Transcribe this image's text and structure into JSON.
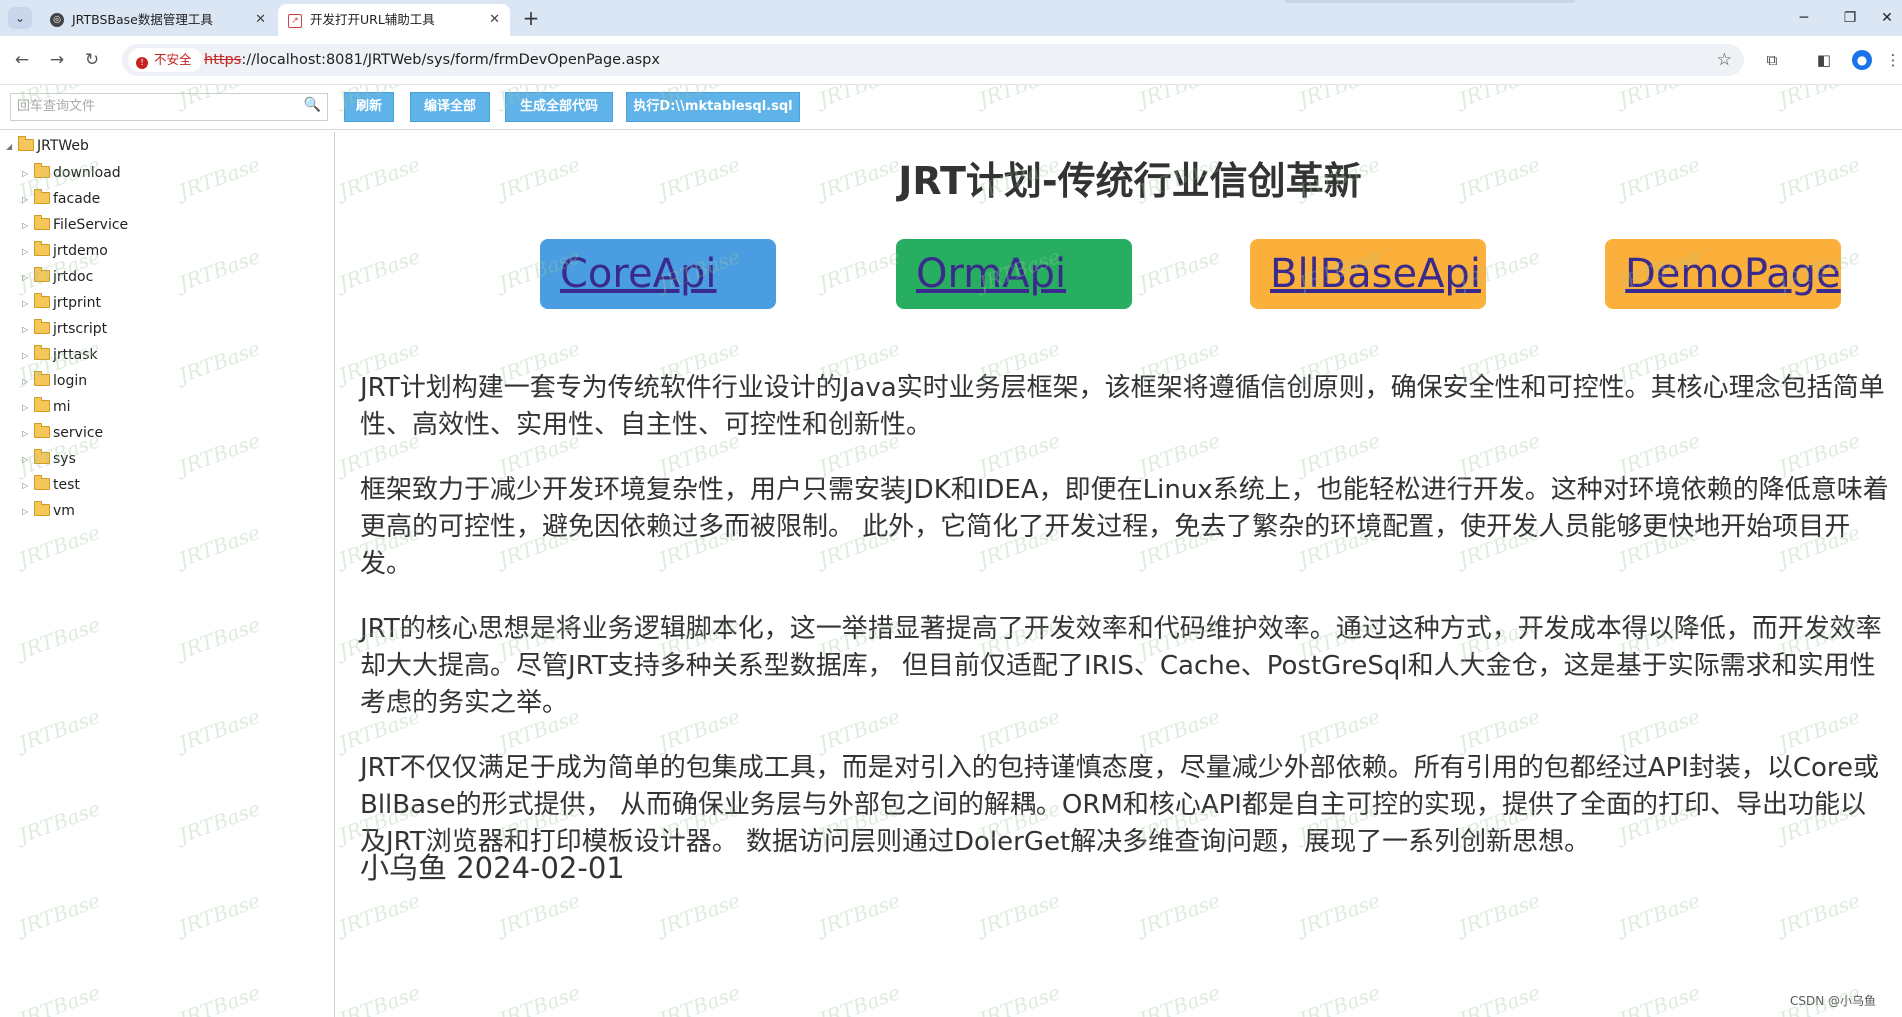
{
  "browser": {
    "tabs": [
      {
        "title": "JRTBSBase数据管理工具",
        "active": false
      },
      {
        "title": "开发打开URL辅助工具",
        "active": true
      }
    ],
    "security_label": "不安全",
    "url_scheme": "https",
    "url_rest": "://localhost:8081/JRTWeb/sys/form/frmDevOpenPage.aspx"
  },
  "toolbar": {
    "search_placeholder": "回车查询文件",
    "buttons": [
      "刷新",
      "编译全部",
      "生成全部代码",
      "执行D:\\\\mktablesql.sql"
    ]
  },
  "tree": {
    "root": "JRTWeb",
    "items": [
      "download",
      "facade",
      "FileService",
      "jrtdemo",
      "jrtdoc",
      "jrtprint",
      "jrtscript",
      "jrttask",
      "login",
      "mi",
      "service",
      "sys",
      "test",
      "vm"
    ]
  },
  "content": {
    "title": "JRT计划-传统行业信创革新",
    "links": [
      {
        "label": "CoreApi",
        "color": "#4a9de0"
      },
      {
        "label": "OrmApi",
        "color": "#27ae60"
      },
      {
        "label": "BllBaseApi",
        "color": "#fbb03b"
      },
      {
        "label": "DemoPage",
        "color": "#fbb03b"
      }
    ],
    "paragraphs": [
      "JRT计划构建一套专为传统软件行业设计的Java实时业务层框架，该框架将遵循信创原则，确保安全性和可控性。其核心理念包括简单性、高效性、实用性、自主性、可控性和创新性。",
      "框架致力于减少开发环境复杂性，用户只需安装JDK和IDEA，即便在Linux系统上，也能轻松进行开发。这种对环境依赖的降低意味着更高的可控性，避免因依赖过多而被限制。 此外，它简化了开发过程，免去了繁杂的环境配置，使开发人员能够更快地开始项目开发。",
      "JRT的核心思想是将业务逻辑脚本化，这一举措显著提高了开发效率和代码维护效率。通过这种方式，开发成本得以降低，而开发效率却大大提高。尽管JRT支持多种关系型数据库， 但目前仅适配了IRIS、Cache、PostGreSql和人大金仓，这是基于实际需求和实用性考虑的务实之举。",
      "JRT不仅仅满足于成为简单的包集成工具，而是对引入的包持谨慎态度，尽量减少外部依赖。所有引用的包都经过API封装，以Core或BllBase的形式提供， 从而确保业务层与外部包之间的解耦。ORM和核心API都是自主可控的实现，提供了全面的打印、导出功能以及JRT浏览器和打印模板设计器。 数据访问层则通过DolerGet解决多维查询问题，展现了一系列创新思想。"
    ],
    "signature": "小乌鱼 2024-02-01"
  },
  "watermark": "JRTBase",
  "csdn_credit": "CSDN @小乌鱼"
}
